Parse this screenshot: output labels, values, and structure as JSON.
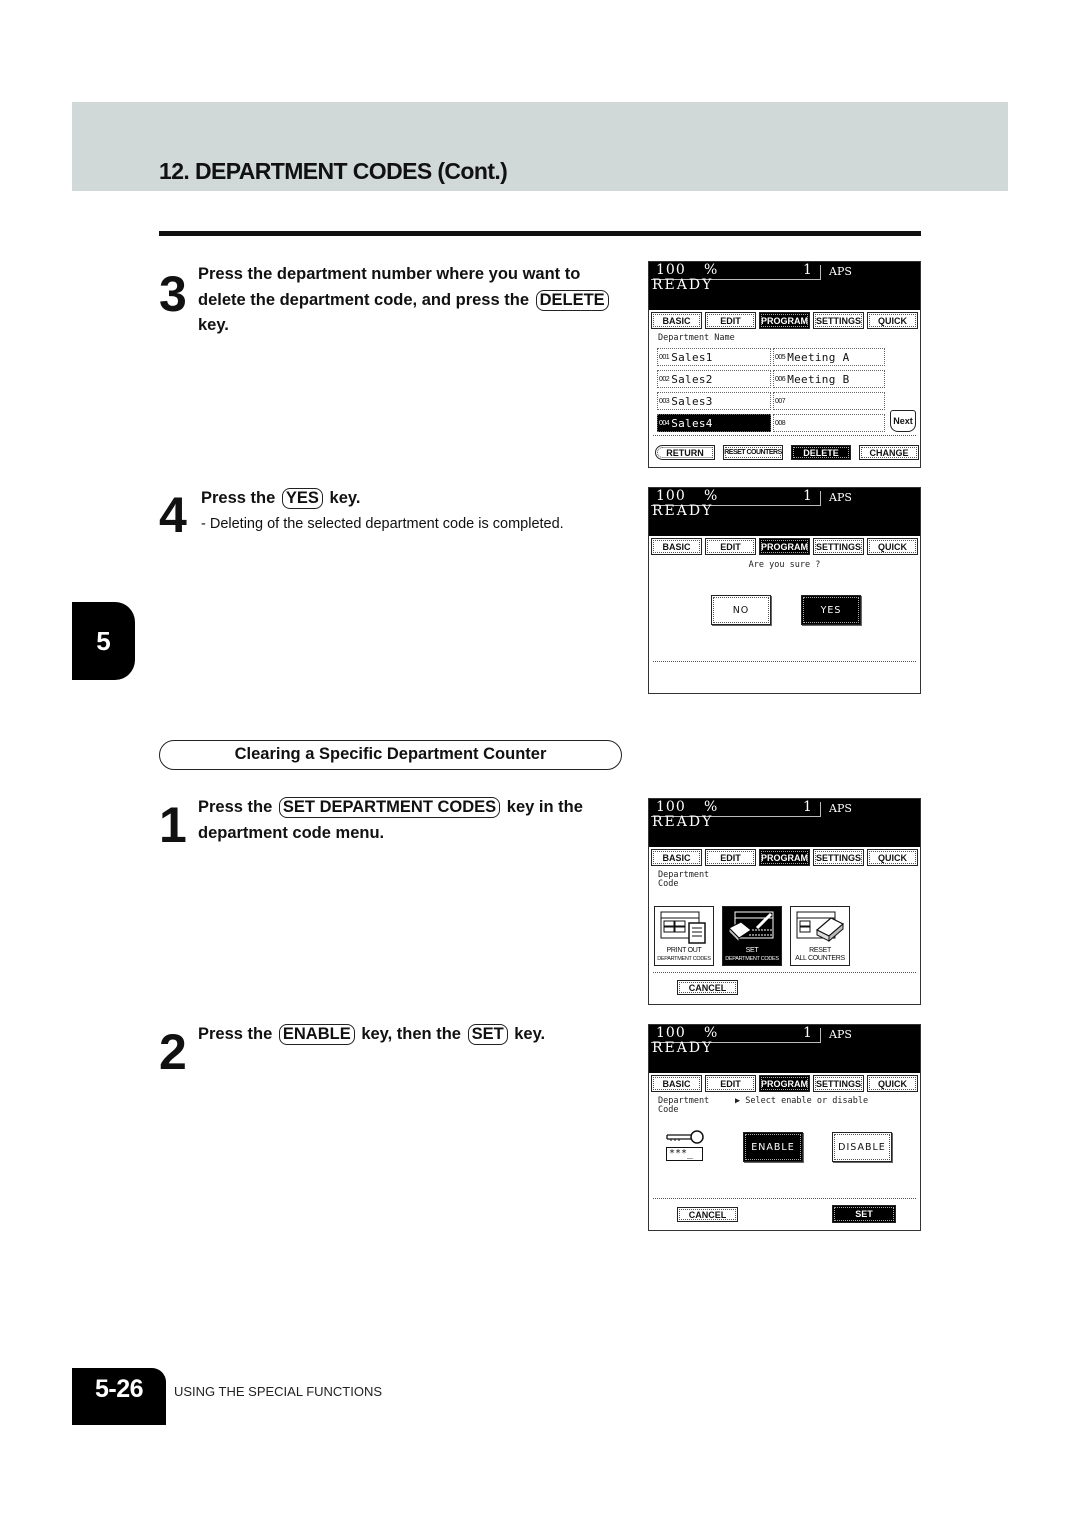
{
  "header": {
    "title": "12. DEPARTMENT CODES (Cont.)",
    "chapter": "5"
  },
  "steps": {
    "step3": {
      "number": "3",
      "line1": "Press the department number where you want to",
      "line2_pre": "delete the department code, and press the",
      "key": "DELETE",
      "line3": "key."
    },
    "step4": {
      "number": "4",
      "pre": "Press the",
      "key": "YES",
      "post": "key.",
      "sub": "-  Deleting of the selected department code is completed."
    },
    "section_title": "Clearing a Specific Department Counter",
    "step1": {
      "number": "1",
      "pre": "Press the",
      "key": "SET DEPARTMENT CODES",
      "post": "key in the",
      "line2": "department code menu."
    },
    "step2": {
      "number": "2",
      "pre": "Press the",
      "key1": "ENABLE",
      "mid": "key, then the",
      "key2": "SET",
      "post": "key."
    }
  },
  "lcd_common": {
    "zoom": "100",
    "pct": "%",
    "copies": "1",
    "paper": "APS",
    "status": "READY",
    "tabs": [
      "BASIC",
      "EDIT",
      "PROGRAM",
      "SETTINGS",
      "QUICK"
    ],
    "active_tab": "PROGRAM"
  },
  "lcd1": {
    "label": "Department Name",
    "departments": [
      {
        "num": "001",
        "name": "Sales1",
        "selected": false
      },
      {
        "num": "002",
        "name": "Sales2",
        "selected": false
      },
      {
        "num": "003",
        "name": "Sales3",
        "selected": false
      },
      {
        "num": "004",
        "name": "Sales4",
        "selected": true
      },
      {
        "num": "005",
        "name": "Meeting A",
        "selected": false
      },
      {
        "num": "006",
        "name": "Meeting B",
        "selected": false
      },
      {
        "num": "007",
        "name": "",
        "selected": false
      },
      {
        "num": "008",
        "name": "",
        "selected": false
      }
    ],
    "next": "Next",
    "buttons": {
      "return": "RETURN",
      "reset_counters": "RESET COUNTERS",
      "delete": "DELETE",
      "change": "CHANGE"
    }
  },
  "lcd2": {
    "prompt": "Are you sure ?",
    "no": "NO",
    "yes": "YES"
  },
  "lcd3": {
    "label_line1": "Department",
    "label_line2": "Code",
    "icons": [
      {
        "line1": "PRINT OUT",
        "line2": "DEPARTMENT CODES"
      },
      {
        "line1": "SET",
        "line2": "DEPARTMENT CODES"
      },
      {
        "line1": "RESET",
        "line2": "ALL COUNTERS"
      }
    ],
    "cancel": "CANCEL"
  },
  "lcd4": {
    "label_line1": "Department",
    "label_line2": "Code",
    "instruction": "Select enable or disable",
    "code_mask": "***_",
    "enable": "ENABLE",
    "disable": "DISABLE",
    "cancel": "CANCEL",
    "set": "SET"
  },
  "footer": {
    "page": "5-26",
    "section": "USING THE SPECIAL FUNCTIONS"
  }
}
